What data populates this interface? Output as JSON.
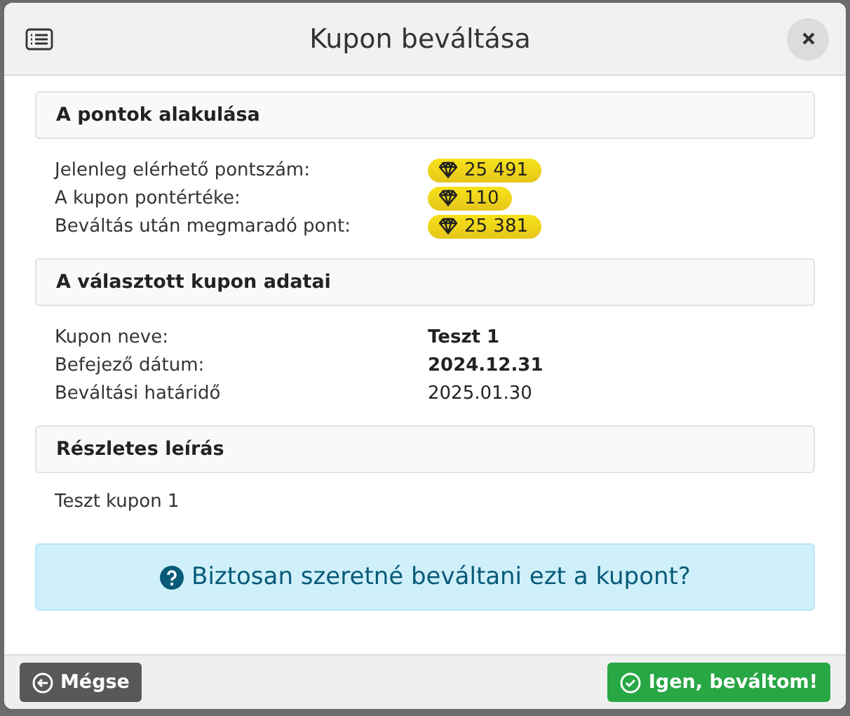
{
  "dialog": {
    "title": "Kupon beváltása"
  },
  "sections": [
    {
      "kind": "points",
      "heading": "A pontok alakulása",
      "rows": [
        {
          "label": "Jelenleg elérhető pontszám:",
          "value": "25 491"
        },
        {
          "label": "A kupon pontértéke:",
          "value": "110"
        },
        {
          "label": "Beváltás után megmaradó pont:",
          "value": "25 381"
        }
      ]
    },
    {
      "kind": "details",
      "heading": "A választott kupon adatai",
      "rows": [
        {
          "label": "Kupon neve:",
          "value": "Teszt 1",
          "bold": true
        },
        {
          "label": "Befejező dátum:",
          "value": "2024.12.31",
          "bold": true
        },
        {
          "label": "Beváltási határidő",
          "value": "2025.01.30",
          "bold": false
        }
      ]
    },
    {
      "kind": "text",
      "heading": "Részletes leírás",
      "text": "Teszt kupon 1"
    }
  ],
  "question": "Biztosan szeretné beváltani ezt a kupont?",
  "buttons": [
    {
      "kind": "cancel",
      "label": "Mégse"
    },
    {
      "kind": "confirm",
      "label": "Igen, beváltom!"
    }
  ]
}
